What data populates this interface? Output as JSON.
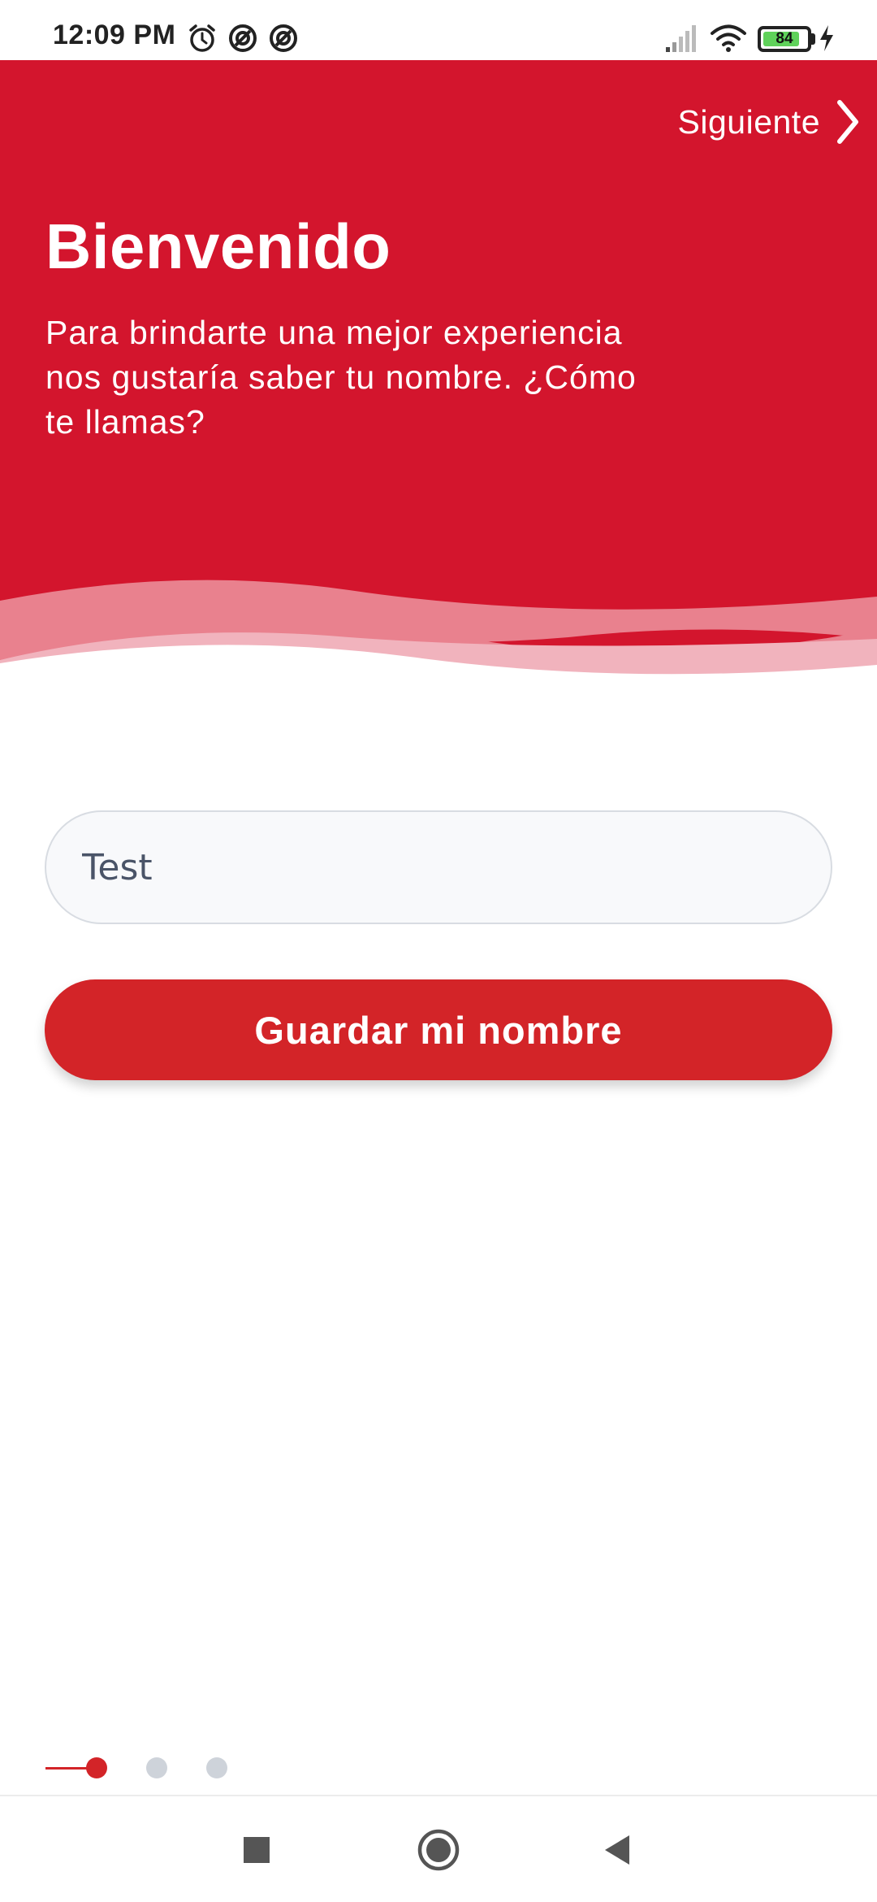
{
  "status_bar": {
    "time": "12:09 PM",
    "battery_level": "84",
    "battery_fraction": 0.84,
    "icons": [
      "alarm-icon",
      "data-saver-icon",
      "data-saver-icon",
      "signal-icon",
      "wifi-icon",
      "battery-icon",
      "charging-icon"
    ]
  },
  "header": {
    "next_label": "Siguiente",
    "next_icon": "chevron-right-icon",
    "title": "Bienvenido",
    "subtitle": "Para brindarte una mejor experiencia nos gustaría saber tu nombre. ¿Cómo te llamas?"
  },
  "form": {
    "name_value": "Test",
    "save_label": "Guardar mi nombre"
  },
  "pager": {
    "pages": 3,
    "current": 1
  },
  "nav_bar": {
    "icons": [
      "recents-icon",
      "home-icon",
      "back-icon"
    ]
  },
  "colors": {
    "brand_red": "#d3152d",
    "button_red": "#d32428",
    "dot_inactive": "#ced3da",
    "wave_light": "#f1b3bd",
    "wave_mid": "#e9818e"
  }
}
